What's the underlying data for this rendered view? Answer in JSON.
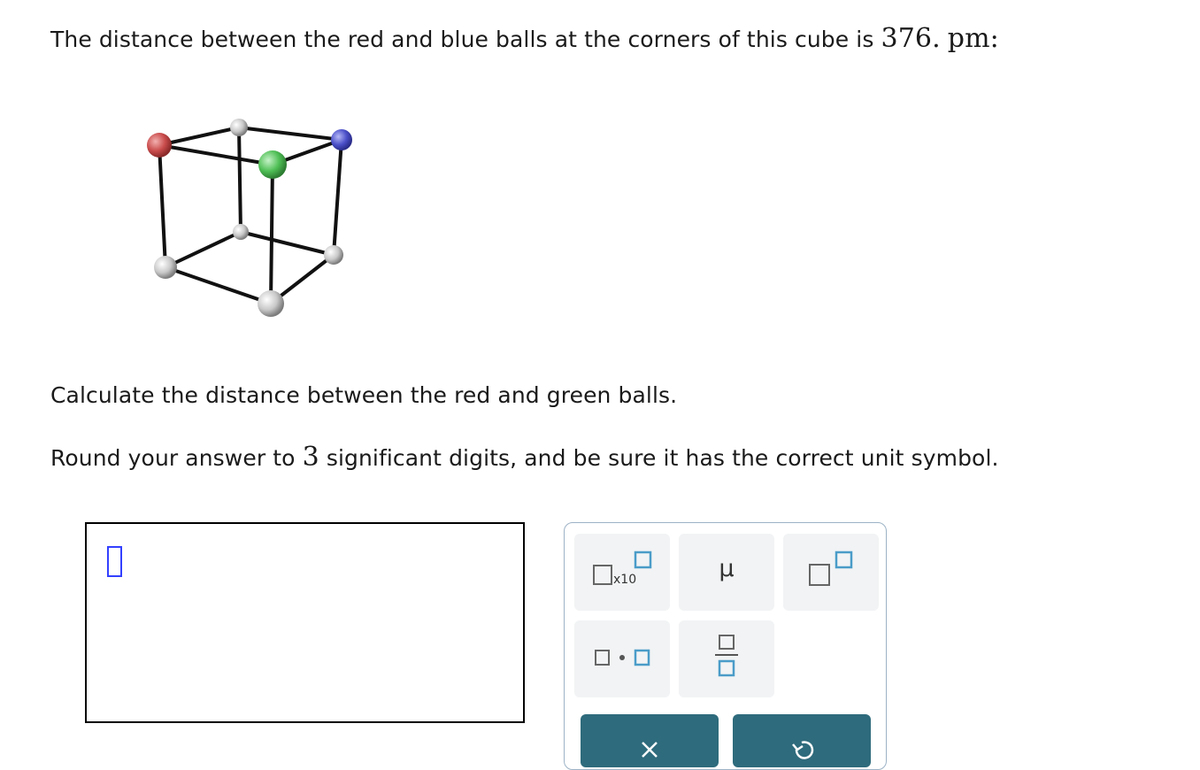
{
  "question": {
    "line1_text": "The distance between the red and blue balls at the corners of this cube is ",
    "line1_value": "376.",
    "line1_unit": "pm:",
    "line2": "Calculate the distance between the red and green balls.",
    "line3_pre": "Round your answer to ",
    "line3_num": "3",
    "line3_post": " significant digits, and be sure it has the correct unit symbol."
  },
  "cube": {
    "ball_colors": {
      "red": "#c94b4b",
      "blue": "#4b50c9",
      "green": "#4fbf55",
      "gray": "#c8c8c8"
    }
  },
  "answer": {
    "value": ""
  },
  "palette": {
    "x10_label": "x10",
    "mu_label": "μ",
    "accent": "#4a9cc8",
    "action_color": "#2e6b7c",
    "clear_icon": "x-icon",
    "undo_icon": "undo-icon"
  }
}
